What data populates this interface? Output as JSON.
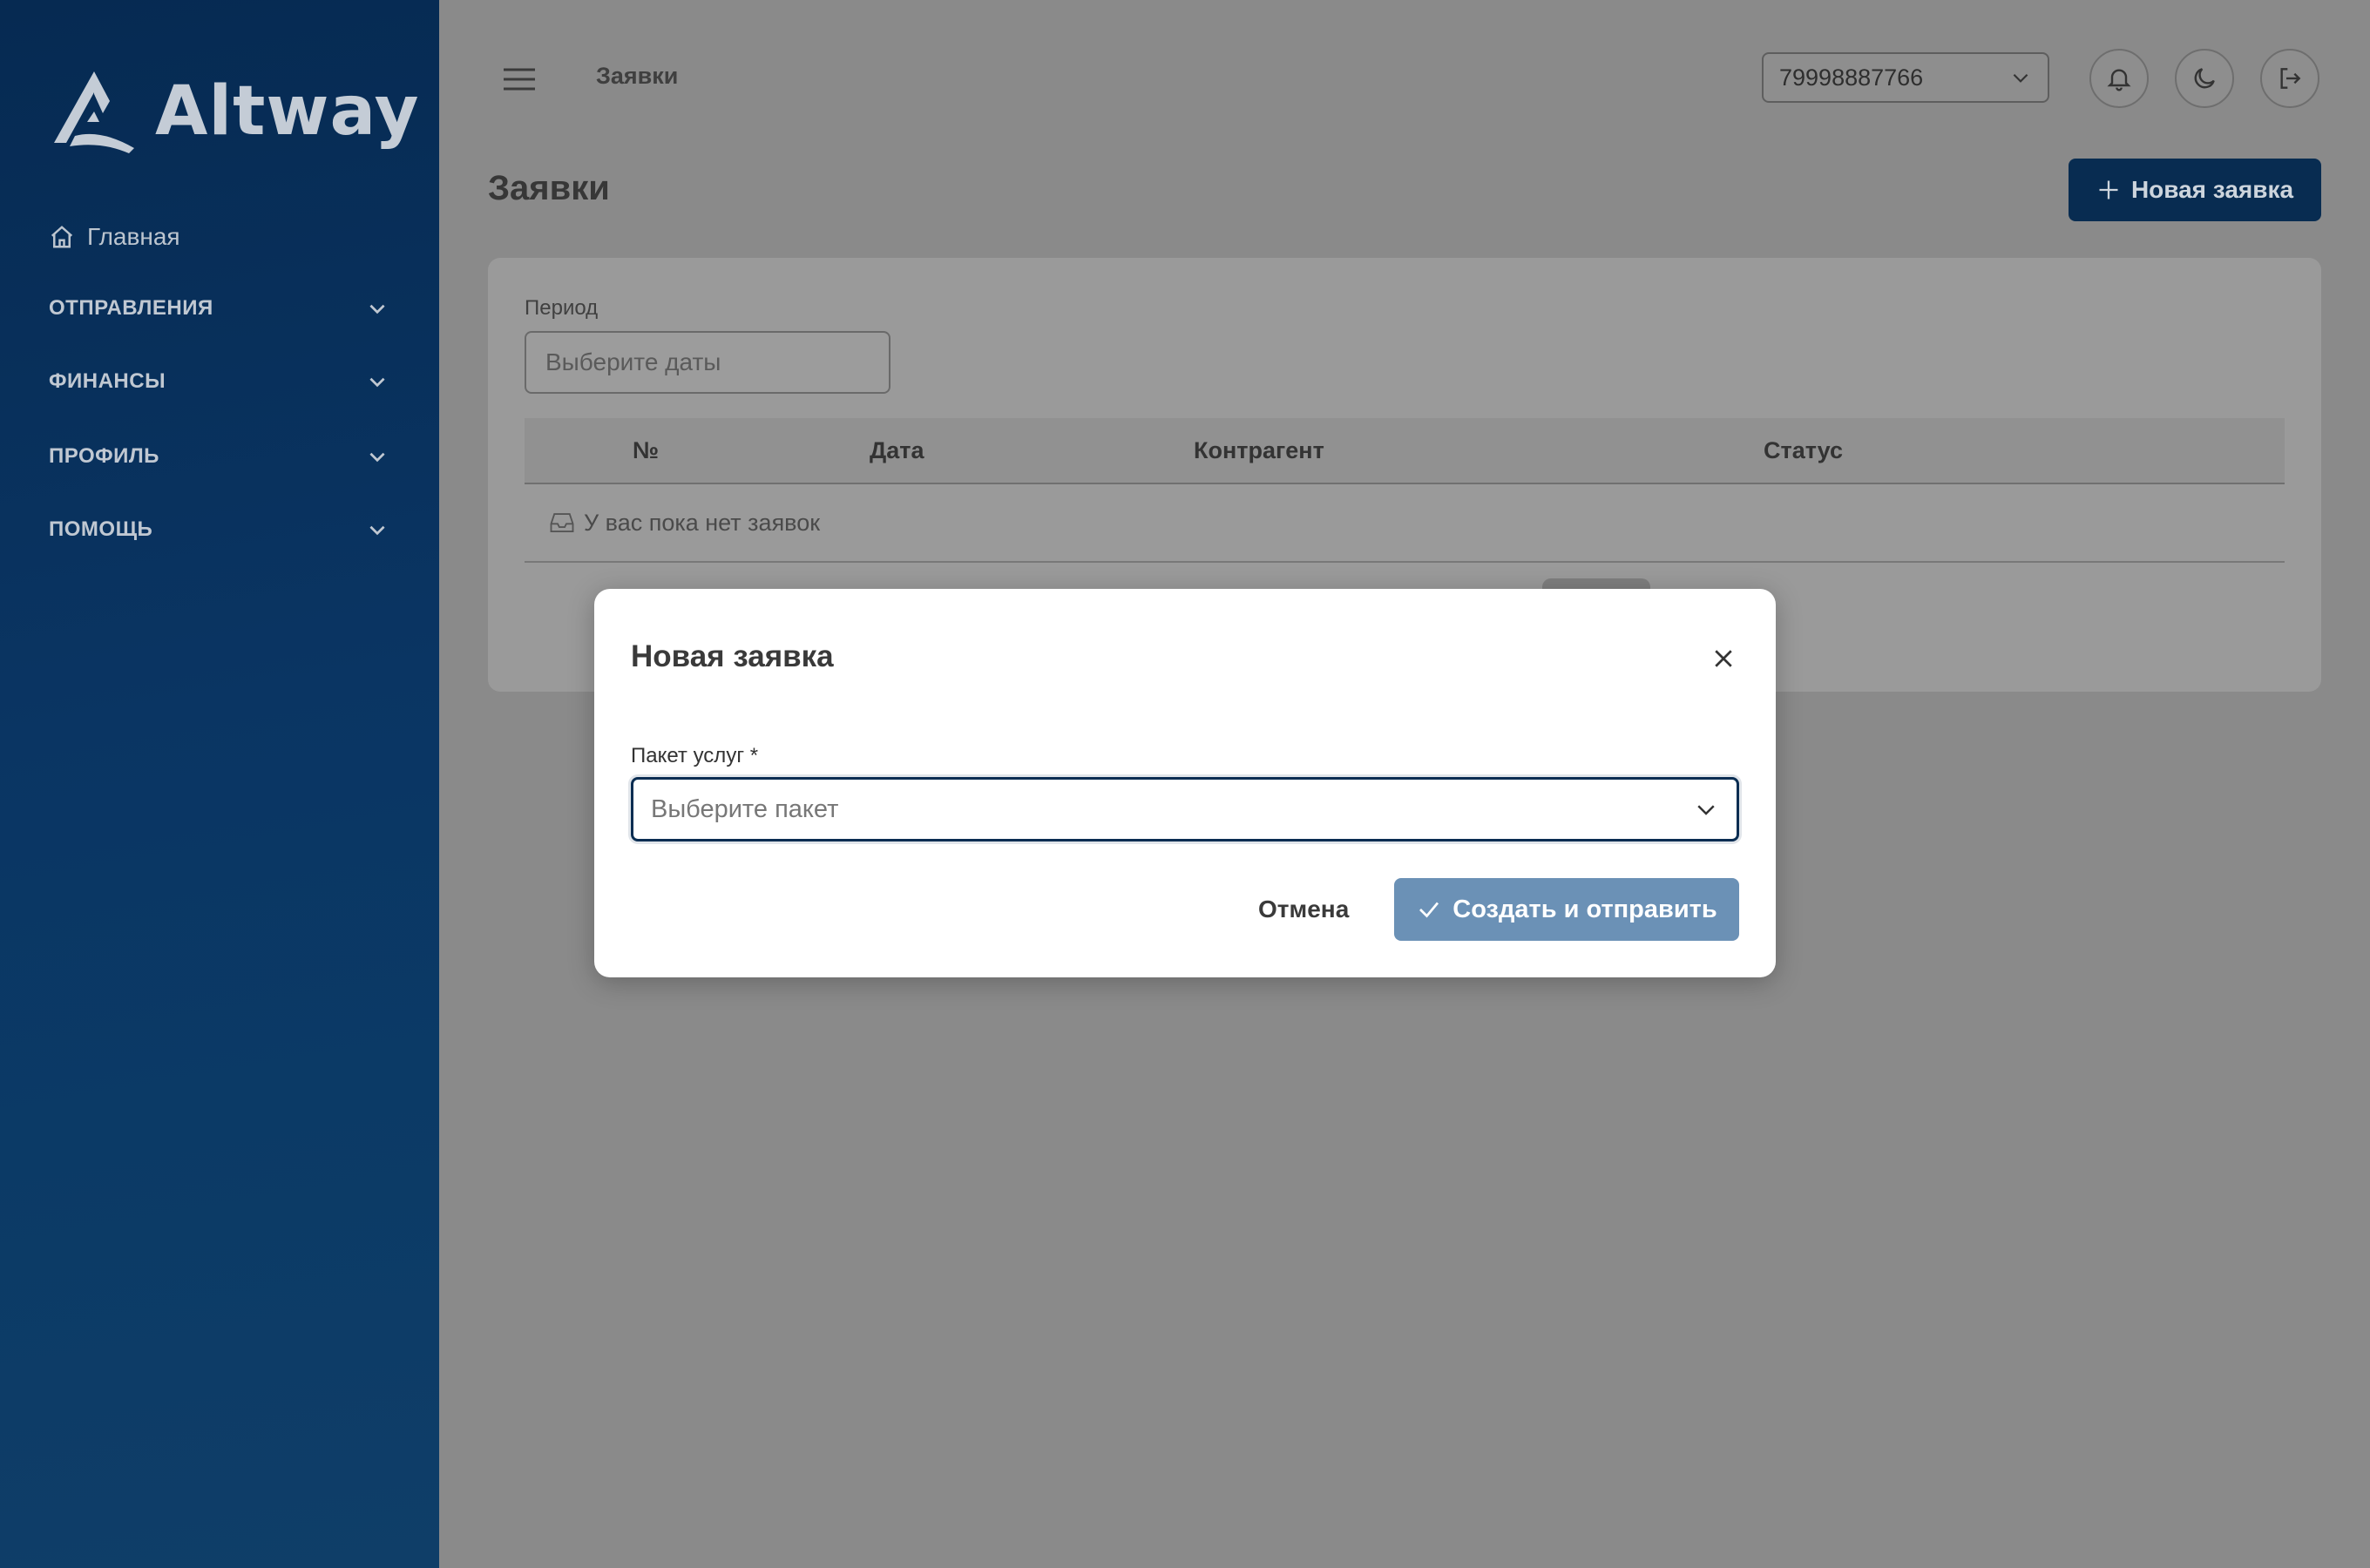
{
  "sidebar": {
    "brand": "Altway",
    "home_label": "Главная",
    "groups": [
      {
        "label": "ОТПРАВЛЕНИЯ"
      },
      {
        "label": "ФИНАНСЫ"
      },
      {
        "label": "ПРОФИЛЬ"
      },
      {
        "label": "ПОМОЩЬ"
      }
    ]
  },
  "header": {
    "breadcrumb": "Заявки",
    "account_select": "79998887766",
    "icons": [
      "bell-icon",
      "moon-icon",
      "logout-icon"
    ]
  },
  "page": {
    "title": "Заявки",
    "new_button": "Новая заявка",
    "filter": {
      "period_label": "Период",
      "period_placeholder": "Выберите даты"
    },
    "table": {
      "columns": [
        "№",
        "Дата",
        "Контрагент",
        "Статус"
      ],
      "empty_text": "У вас пока нет заявок"
    }
  },
  "modal": {
    "title": "Новая заявка",
    "package_label": "Пакет услуг *",
    "package_placeholder": "Выберите пакет",
    "cancel_label": "Отмена",
    "submit_label": "Создать и отправить"
  },
  "colors": {
    "sidebar": "#0a3563",
    "primary": "#082c51",
    "submit": "#6b91b6",
    "overlay": "#8a8a8a"
  }
}
